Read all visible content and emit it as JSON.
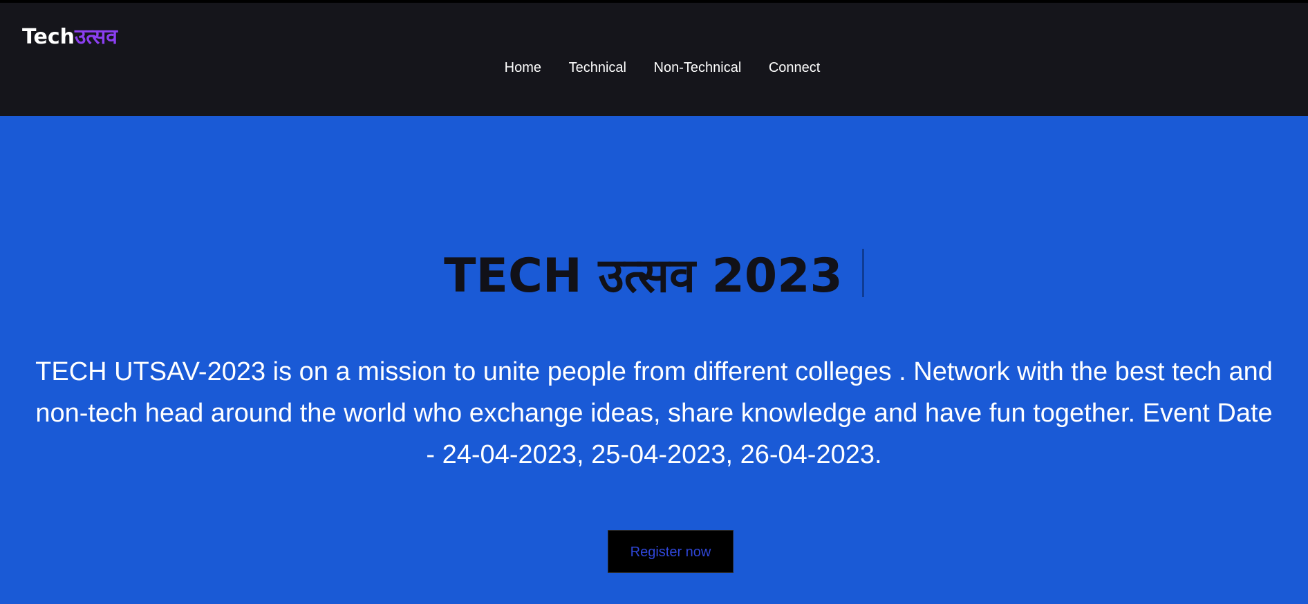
{
  "brand": {
    "part1": "Tech",
    "part2": "उत्सव"
  },
  "nav": {
    "items": [
      "Home",
      "Technical",
      "Non-Technical",
      "Connect"
    ]
  },
  "hero": {
    "title": "TECH उत्सव 2023",
    "description": "TECH UTSAV-2023 is on a mission to unite people from different colleges . Network with the best tech and non-tech head around the world who exchange ideas, share knowledge and have fun together. Event Date - 24-04-2023, 25-04-2023, 26-04-2023.",
    "register_label": "Register now"
  },
  "colors": {
    "navbar_bg": "#15151b",
    "hero_bg": "#1a5ad6",
    "brand_accent": "#8b3ff0",
    "button_bg": "#000000",
    "button_text": "#2f46d8"
  }
}
